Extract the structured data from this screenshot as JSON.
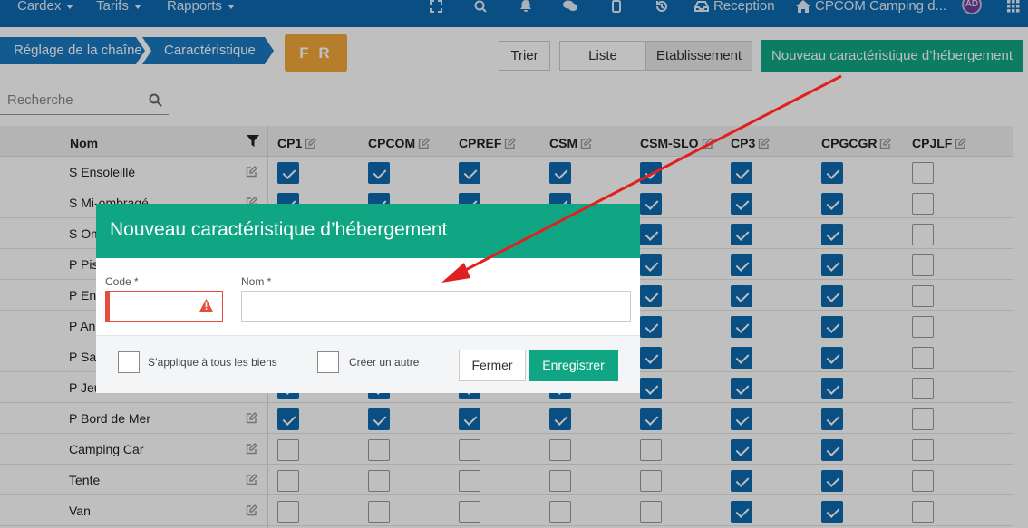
{
  "topnav": {
    "menus": [
      {
        "label": "Cardex"
      },
      {
        "label": "Tarifs"
      },
      {
        "label": "Rapports"
      }
    ],
    "reception_label": "Reception",
    "property_label": "CPCOM Camping d...",
    "avatar_initials": "AD",
    "bg_color": "#0d6ab0"
  },
  "breadcrumb": {
    "items": [
      "Réglage de la chaîne",
      "Caractéristique"
    ]
  },
  "language_badge": "F R",
  "toolbar": {
    "sort_label": "Trier",
    "list_label": "Liste",
    "establishment_label": "Etablissement",
    "new_label": "Nouveau caractéristique d’hébergement",
    "accent_color": "#11a683"
  },
  "search": {
    "placeholder": "Recherche"
  },
  "grid": {
    "name_header": "Nom",
    "columns": [
      "CP1",
      "CPCOM",
      "CPREF",
      "CSM",
      "CSM-SLO",
      "CP3",
      "CPGCGR",
      "CPJLF"
    ],
    "rows": [
      {
        "name": "S Ensoleillé",
        "checks": [
          true,
          true,
          true,
          true,
          true,
          true,
          true,
          false
        ]
      },
      {
        "name": "S Mi-ombragé",
        "checks": [
          true,
          true,
          true,
          true,
          true,
          true,
          true,
          false
        ]
      },
      {
        "name": "S Ombragé",
        "checks": [
          true,
          true,
          true,
          true,
          true,
          true,
          true,
          false
        ]
      },
      {
        "name": "P Piscine",
        "checks": [
          true,
          true,
          true,
          true,
          true,
          true,
          true,
          false
        ]
      },
      {
        "name": "P Enfants",
        "checks": [
          true,
          true,
          true,
          true,
          true,
          true,
          true,
          false
        ]
      },
      {
        "name": "P Animaux",
        "checks": [
          true,
          true,
          true,
          true,
          true,
          true,
          true,
          false
        ]
      },
      {
        "name": "P Sanitaires",
        "checks": [
          true,
          true,
          true,
          true,
          true,
          true,
          true,
          false
        ]
      },
      {
        "name": "P Jeux",
        "checks": [
          true,
          true,
          true,
          true,
          true,
          true,
          true,
          false
        ]
      },
      {
        "name": "P Bord de Mer",
        "checks": [
          true,
          true,
          true,
          true,
          true,
          true,
          true,
          false
        ]
      },
      {
        "name": "Camping Car",
        "checks": [
          false,
          false,
          false,
          false,
          false,
          true,
          true,
          false
        ]
      },
      {
        "name": "Tente",
        "checks": [
          false,
          false,
          false,
          false,
          false,
          true,
          true,
          false
        ]
      },
      {
        "name": "Van",
        "checks": [
          false,
          false,
          false,
          false,
          false,
          true,
          true,
          false
        ]
      }
    ]
  },
  "modal": {
    "title": "Nouveau caractéristique d’hébergement",
    "code_label": "Code *",
    "code_value": "",
    "name_label": "Nom *",
    "name_value": "",
    "apply_all_label": "S’applique à tous les biens",
    "create_another_label": "Créer un autre",
    "close_label": "Fermer",
    "save_label": "Enregistrer",
    "error_color": "#e74c3c"
  },
  "annotation": {
    "arrow_color": "#e02020"
  }
}
